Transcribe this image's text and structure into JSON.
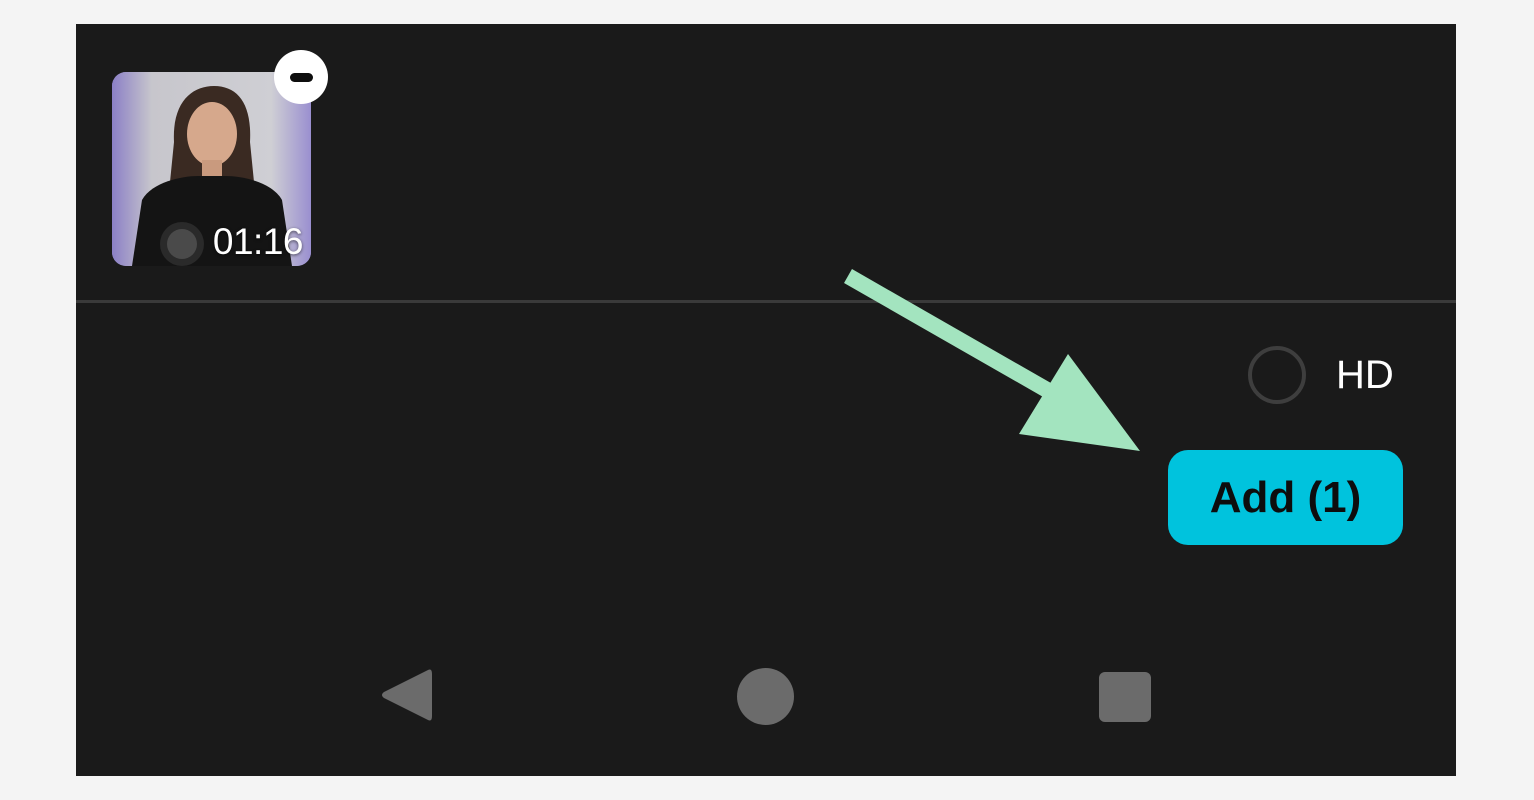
{
  "selected_media": {
    "items": [
      {
        "duration": "01:16",
        "remove_icon": "minus-circle-icon"
      }
    ]
  },
  "hd_toggle": {
    "label": "HD",
    "checked": false
  },
  "add_button": {
    "label": "Add (1)"
  },
  "annotation": {
    "icon": "arrow-pointer-icon"
  },
  "nav_bar": {
    "back_icon": "triangle-back-icon",
    "home_icon": "circle-home-icon",
    "recents_icon": "square-recents-icon"
  },
  "colors": {
    "background": "#1a1a1a",
    "page": "#f4f4f4",
    "accent": "#00c3dd",
    "arrow": "#a3e4bf",
    "nav_icons": "#6b6b6b"
  }
}
